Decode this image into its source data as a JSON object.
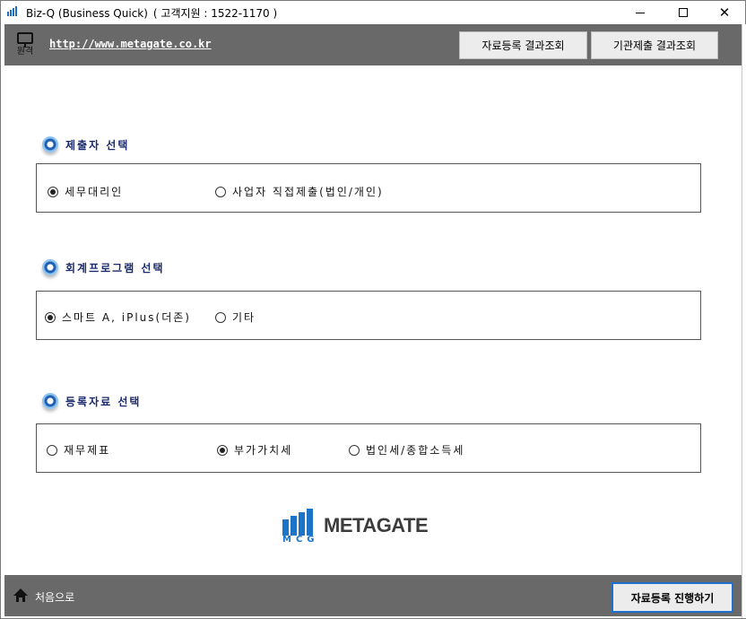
{
  "titlebar": {
    "icon": "bar-chart-icon",
    "title": "Biz-Q (Business Quick)",
    "support": "( 고객지원 : 1522-1170 )",
    "close_glyph": "✕"
  },
  "topbar": {
    "remote_icon": "monitor-icon",
    "remote_label": "원격",
    "url": "http://www.metagate.co.kr",
    "btn_registration_results": "자료등록 결과조회",
    "btn_agency_results": "기관제출 결과조회"
  },
  "sections": {
    "submitter": {
      "title": "제출자 선택",
      "options": [
        {
          "label": "세무대리인",
          "selected": true
        },
        {
          "label": "사업자 직접제출(법인/개인)",
          "selected": false
        }
      ]
    },
    "program": {
      "title": "회계프로그램 선택",
      "options": [
        {
          "label": "스마트 A, iPlus(더존)",
          "selected": true
        },
        {
          "label": "기타",
          "selected": false
        }
      ]
    },
    "data": {
      "title": "등록자료 선택",
      "options": [
        {
          "label": "재무제표",
          "selected": false
        },
        {
          "label": "부가가치세",
          "selected": true
        },
        {
          "label": "법인세/종합소득세",
          "selected": false
        }
      ]
    }
  },
  "logo": {
    "mcg": "MCG",
    "name": "METAGATE"
  },
  "bottombar": {
    "home_icon": "home-icon",
    "first_label": "처음으로",
    "proceed_label": "자료등록 진행하기"
  },
  "colors": {
    "bar_gray": "#696969",
    "section_title": "#1a2a6c",
    "logo_blue": "#1d73c7",
    "accent_border": "#1e6fd0"
  }
}
